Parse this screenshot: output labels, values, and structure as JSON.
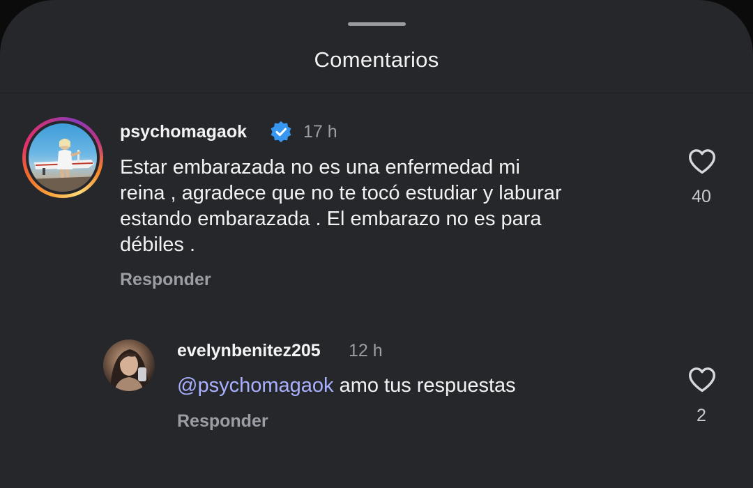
{
  "sheet": {
    "title": "Comentarios"
  },
  "comments": [
    {
      "username": "psychomagaok",
      "verified": true,
      "time": "17 h",
      "text": "Estar embarazada no es una enfermedad mi reina , agradece que no te tocó estudiar y laburar estando embarazada . El embarazo no es para débiles .",
      "lines": [
        "Estar embarazada no es una enfermedad mi",
        "reina , agradece que no te tocó estudiar y laburar",
        "estando embarazada . El embarazo no es para",
        "débiles ."
      ],
      "reply_label": "Responder",
      "likes": "40",
      "like_icon": "heart-outline-icon"
    },
    {
      "username": "evelynbenitez205",
      "time": "12 h",
      "mention": "@psychomagaok",
      "text": "amo tus respuestas",
      "reply_label": "Responder",
      "likes": "2",
      "like_icon": "heart-outline-icon"
    }
  ],
  "colors": {
    "sheet_bg": "#25272b",
    "mention": "#a8b0ff",
    "verified": "#3797f0",
    "secondary_text": "#9b9ea4"
  }
}
